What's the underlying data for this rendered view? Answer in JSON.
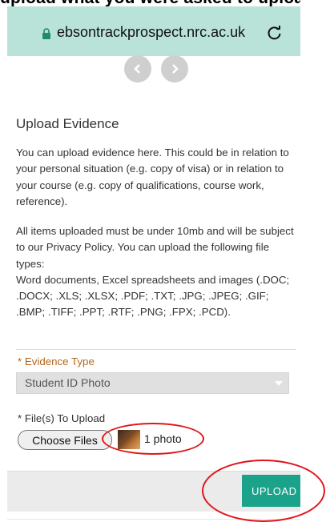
{
  "header_crop": "upload what you were asked to upload",
  "browser": {
    "url": "ebsontrackprospect.nrc.ac.uk"
  },
  "page": {
    "title": "Upload Evidence",
    "intro": "You can upload evidence here.  This could be in relation to your personal situation (e.g. copy of visa) or in relation to your course (e.g. copy of qualifications, course work, reference).",
    "rules_line1": "All items uploaded must be under 10mb and will be subject to our Privacy Policy. You can upload the following file types:",
    "rules_line2": "Word documents, Excel spreadsheets and images (.DOC; .DOCX; .XLS; .XLSX; .PDF; .TXT; .JPG; .JPEG; .GIF; .BMP; .TIFF; .PPT; .RTF; .PNG; .FPX; .PCD)."
  },
  "form": {
    "evidence_type_label": "* Evidence Type",
    "evidence_type_value": "Student ID Photo",
    "files_label": "* File(s) To Upload",
    "choose_files": "Choose Files",
    "file_count": "1 photo",
    "upload_label": "UPLOAD"
  },
  "colors": {
    "accent": "#1aa38a",
    "label_orange": "#b5651d",
    "url_bar": "#b9e3d8",
    "annotation_red": "#e0141b"
  }
}
